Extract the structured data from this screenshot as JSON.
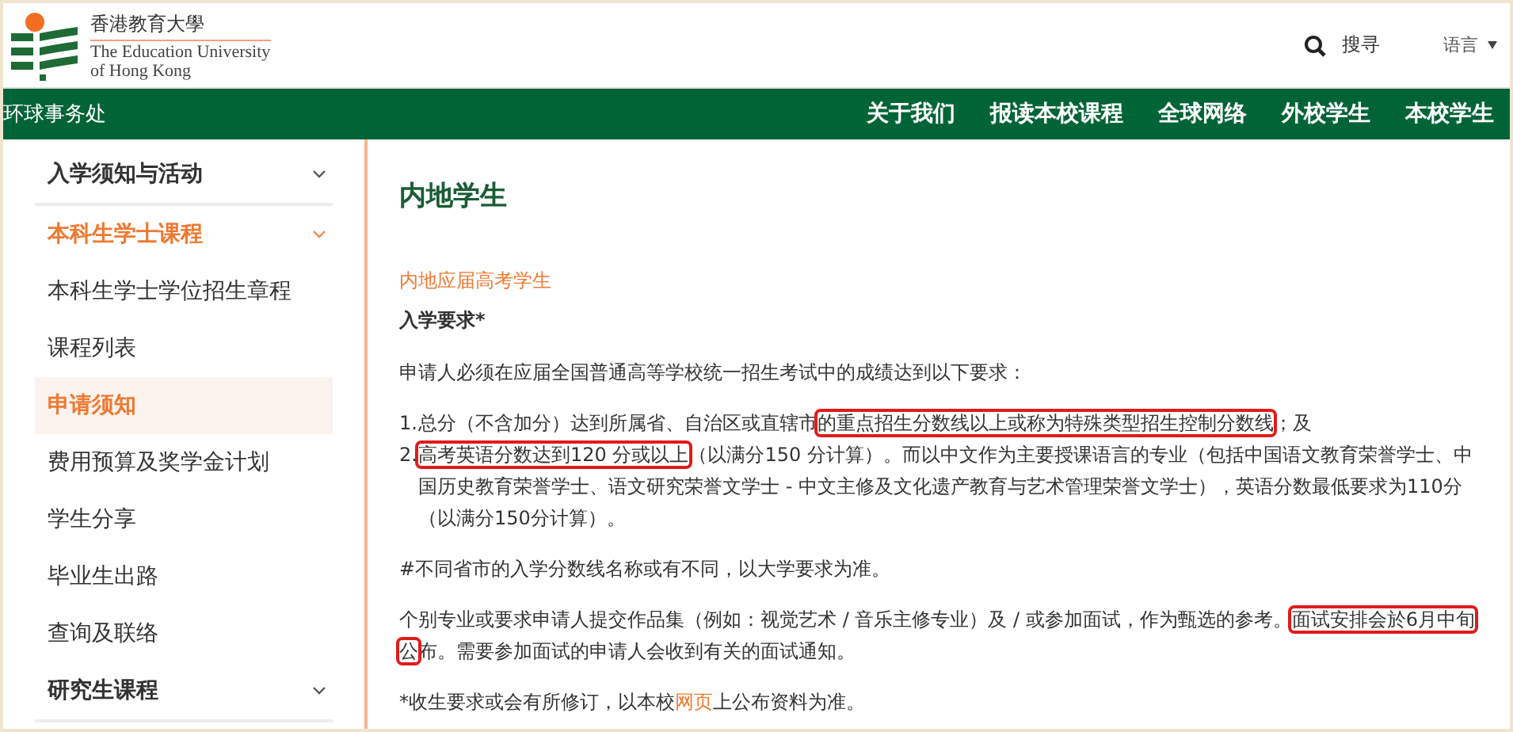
{
  "header": {
    "logo_chinese": "香港教育大學",
    "logo_english": [
      "The Education University",
      "of Hong Kong"
    ],
    "search_label": "搜寻",
    "language_label": "语言"
  },
  "nav": {
    "site_title": "环球事务处",
    "links": [
      "关于我们",
      "报读本校课程",
      "全球网络",
      "外校学生",
      "本校学生"
    ]
  },
  "sidebar": {
    "items": [
      {
        "kind": "section",
        "label": "入学须知与活动",
        "selected": false
      },
      {
        "kind": "section",
        "label": "本科生学士课程",
        "selected": true
      },
      {
        "kind": "link",
        "label": "本科生学士学位招生章程",
        "selected": false
      },
      {
        "kind": "link",
        "label": "课程列表",
        "selected": false
      },
      {
        "kind": "link",
        "label": "申请须知",
        "selected": true
      },
      {
        "kind": "link",
        "label": "费用预算及奖学金计划",
        "selected": false
      },
      {
        "kind": "link",
        "label": "学生分享",
        "selected": false
      },
      {
        "kind": "link",
        "label": "毕业生出路",
        "selected": false
      },
      {
        "kind": "link",
        "label": "查询及联络",
        "selected": false
      },
      {
        "kind": "section",
        "label": "研究生课程",
        "selected": false
      }
    ]
  },
  "content": {
    "title": "内地学生",
    "subtitle": "内地应届高考学生",
    "requirements_heading": "入学要求*",
    "intro": "申请人必须在应届全国普通高等学校统一招生考试中的成绩达到以下要求：",
    "list": [
      {
        "number": "1.",
        "parts": [
          {
            "text": "总分（不含加分）达到所属省、自治区或直辖市",
            "highlighted": false
          },
          {
            "text": "的重点招生分数线以上或称为特殊类型招生控制分数线",
            "highlighted": true
          },
          {
            "text": "；及",
            "highlighted": false
          }
        ]
      },
      {
        "number": "2.",
        "parts": [
          {
            "text": "高考英语分数达到120 分或以上",
            "highlighted": true
          },
          {
            "text": "（以满分150 分计算）。而以中文作为主要授课语言的专业（包括中国语文教育荣誉学士、中国历史教育荣誉学士、语文研究荣誉文学士 - 中文主修及文化遗产教育与艺术管理荣誉文学士），英语分数最低要求为110分（以满分150分计算）。",
            "highlighted": false
          }
        ]
      }
    ],
    "note": "#不同省市的入学分数线名称或有不同，以大学要求为准。",
    "interview": [
      {
        "text": "个别专业或要求申请人提交作品集（例如：视觉艺术 / 音乐主修专业）及 / 或参加面试，作为甄选的参考。",
        "highlighted": false
      },
      {
        "text": "面试安排会於6月中旬公",
        "highlighted": true
      },
      {
        "text": "布。需要参加面试的申请人会收到有关的面试通知。",
        "highlighted": false
      }
    ],
    "footnote_before": "*收生要求或会有所修订，以本校",
    "footnote_link": "网页",
    "footnote_after": "上公布资料为准。"
  }
}
